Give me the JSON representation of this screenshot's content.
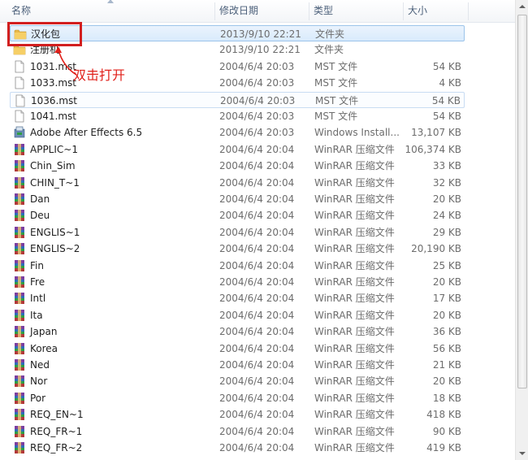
{
  "columns": {
    "name": "名称",
    "date": "修改日期",
    "type": "类型",
    "size": "大小"
  },
  "annotation": "双击打开",
  "colors": {
    "accent_red": "#d21f1f",
    "selection": "#d9ebfc",
    "header_text": "#4c607a"
  },
  "files": [
    {
      "icon": "folder-icon",
      "name": "汉化包",
      "date": "2013/9/10 22:21",
      "type": "文件夹",
      "size": "",
      "selected": true
    },
    {
      "icon": "folder-icon",
      "name": "注册机",
      "date": "2013/9/10 22:21",
      "type": "文件夹",
      "size": ""
    },
    {
      "icon": "file-icon",
      "name": "1031.mst",
      "date": "2004/6/4 20:03",
      "type": "MST 文件",
      "size": "54 KB"
    },
    {
      "icon": "file-icon",
      "name": "1033.mst",
      "date": "2004/6/4 20:03",
      "type": "MST 文件",
      "size": "4 KB"
    },
    {
      "icon": "file-icon",
      "name": "1036.mst",
      "date": "2004/6/4 20:03",
      "type": "MST 文件",
      "size": "54 KB",
      "hover": true
    },
    {
      "icon": "file-icon",
      "name": "1041.mst",
      "date": "2004/6/4 20:03",
      "type": "MST 文件",
      "size": "54 KB"
    },
    {
      "icon": "installer-icon",
      "name": "Adobe After Effects 6.5",
      "date": "2004/6/4 20:03",
      "type": "Windows Install...",
      "size": "13,107 KB"
    },
    {
      "icon": "winrar-icon",
      "name": "APPLIC~1",
      "date": "2004/6/4 20:04",
      "type": "WinRAR 压缩文件",
      "size": "106,374 KB"
    },
    {
      "icon": "winrar-icon",
      "name": "Chin_Sim",
      "date": "2004/6/4 20:04",
      "type": "WinRAR 压缩文件",
      "size": "33 KB"
    },
    {
      "icon": "winrar-icon",
      "name": "CHIN_T~1",
      "date": "2004/6/4 20:04",
      "type": "WinRAR 压缩文件",
      "size": "32 KB"
    },
    {
      "icon": "winrar-icon",
      "name": "Dan",
      "date": "2004/6/4 20:04",
      "type": "WinRAR 压缩文件",
      "size": "20 KB"
    },
    {
      "icon": "winrar-icon",
      "name": "Deu",
      "date": "2004/6/4 20:04",
      "type": "WinRAR 压缩文件",
      "size": "24 KB"
    },
    {
      "icon": "winrar-icon",
      "name": "ENGLIS~1",
      "date": "2004/6/4 20:04",
      "type": "WinRAR 压缩文件",
      "size": "29 KB"
    },
    {
      "icon": "winrar-icon",
      "name": "ENGLIS~2",
      "date": "2004/6/4 20:04",
      "type": "WinRAR 压缩文件",
      "size": "20,190 KB"
    },
    {
      "icon": "winrar-icon",
      "name": "Fin",
      "date": "2004/6/4 20:04",
      "type": "WinRAR 压缩文件",
      "size": "25 KB"
    },
    {
      "icon": "winrar-icon",
      "name": "Fre",
      "date": "2004/6/4 20:04",
      "type": "WinRAR 压缩文件",
      "size": "20 KB"
    },
    {
      "icon": "winrar-icon",
      "name": "Intl",
      "date": "2004/6/4 20:04",
      "type": "WinRAR 压缩文件",
      "size": "17 KB"
    },
    {
      "icon": "winrar-icon",
      "name": "Ita",
      "date": "2004/6/4 20:04",
      "type": "WinRAR 压缩文件",
      "size": "20 KB"
    },
    {
      "icon": "winrar-icon",
      "name": "Japan",
      "date": "2004/6/4 20:04",
      "type": "WinRAR 压缩文件",
      "size": "36 KB"
    },
    {
      "icon": "winrar-icon",
      "name": "Korea",
      "date": "2004/6/4 20:04",
      "type": "WinRAR 压缩文件",
      "size": "56 KB"
    },
    {
      "icon": "winrar-icon",
      "name": "Ned",
      "date": "2004/6/4 20:04",
      "type": "WinRAR 压缩文件",
      "size": "21 KB"
    },
    {
      "icon": "winrar-icon",
      "name": "Nor",
      "date": "2004/6/4 20:04",
      "type": "WinRAR 压缩文件",
      "size": "20 KB"
    },
    {
      "icon": "winrar-icon",
      "name": "Por",
      "date": "2004/6/4 20:04",
      "type": "WinRAR 压缩文件",
      "size": "18 KB"
    },
    {
      "icon": "winrar-icon",
      "name": "REQ_EN~1",
      "date": "2004/6/4 20:04",
      "type": "WinRAR 压缩文件",
      "size": "418 KB"
    },
    {
      "icon": "winrar-icon",
      "name": "REQ_FR~1",
      "date": "2004/6/4 20:04",
      "type": "WinRAR 压缩文件",
      "size": "90 KB"
    },
    {
      "icon": "winrar-icon",
      "name": "REQ_FR~2",
      "date": "2004/6/4 20:04",
      "type": "WinRAR 压缩文件",
      "size": "419 KB"
    }
  ]
}
